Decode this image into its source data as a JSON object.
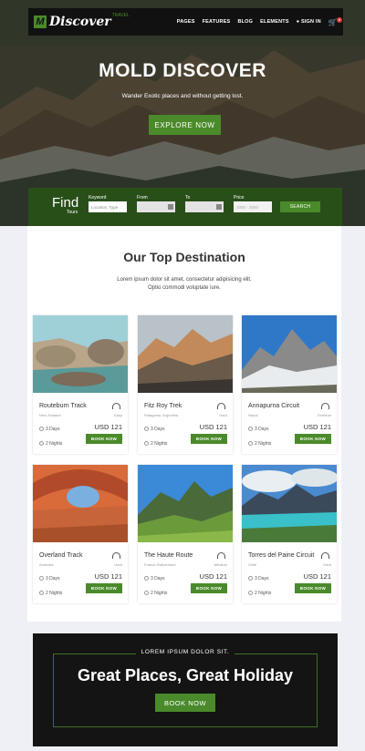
{
  "brand": {
    "name": "Discover",
    "tag": "TRAVEL"
  },
  "nav": {
    "items": [
      "PAGES",
      "FEATURES",
      "BLOG",
      "ELEMENTS"
    ],
    "signin": "SIGN IN",
    "cart_count": "0"
  },
  "hero": {
    "title": "MOLD DISCOVER",
    "subtitle": "Wander Exotic places and without getting lost.",
    "cta": "EXPLORE NOW"
  },
  "find": {
    "title": "Find",
    "subtitle": "Tours",
    "keyword_label": "Keyword",
    "keyword_placeholder": "Location, Type",
    "from_label": "From",
    "to_label": "To",
    "price_label": "Price",
    "price_value": "1000 - 2000",
    "search": "SEARCH"
  },
  "destinations": {
    "title": "Our Top Destination",
    "description_line1": "Lorem ipsum dolor sit amet, consectetur adipisicing elit.",
    "description_line2": "Optio commodi voluptate iure.",
    "cards": [
      {
        "name": "Routeburn Track",
        "location": "New Zealand",
        "difficulty": "Easy",
        "days": "3 Days",
        "nights": "2 Nights",
        "price": "USD 121",
        "cta": "BOOK NOW"
      },
      {
        "name": "Fitz Roy Trek",
        "location": "Patagonia, Argentina",
        "difficulty": "Hard",
        "days": "3 Days",
        "nights": "2 Nights",
        "price": "USD 121",
        "cta": "BOOK NOW"
      },
      {
        "name": "Annapurna Circuit",
        "location": "Nepal",
        "difficulty": "Extreme",
        "days": "3 Days",
        "nights": "2 Nights",
        "price": "USD 121",
        "cta": "BOOK NOW"
      },
      {
        "name": "Overland Track",
        "location": "Australia",
        "difficulty": "Hard",
        "days": "3 Days",
        "nights": "2 Nights",
        "price": "USD 121",
        "cta": "BOOK NOW"
      },
      {
        "name": "The Haute Route",
        "location": "France-Switzerland",
        "difficulty": "Medium",
        "days": "3 Days",
        "nights": "2 Nights",
        "price": "USD 121",
        "cta": "BOOK NOW"
      },
      {
        "name": "Torres del Paine Circuit",
        "location": "Chile",
        "difficulty": "Hard",
        "days": "3 Days",
        "nights": "2 Nights",
        "price": "USD 121",
        "cta": "BOOK NOW"
      }
    ]
  },
  "promo": {
    "label": "LOREM IPSUM DOLOR SIT.",
    "title": "Great Places, Great Holiday",
    "cta": "BOOK NOW"
  },
  "colors": {
    "accent": "#4a8a2a",
    "dark": "#141414",
    "page_bg": "#eef0f5"
  }
}
